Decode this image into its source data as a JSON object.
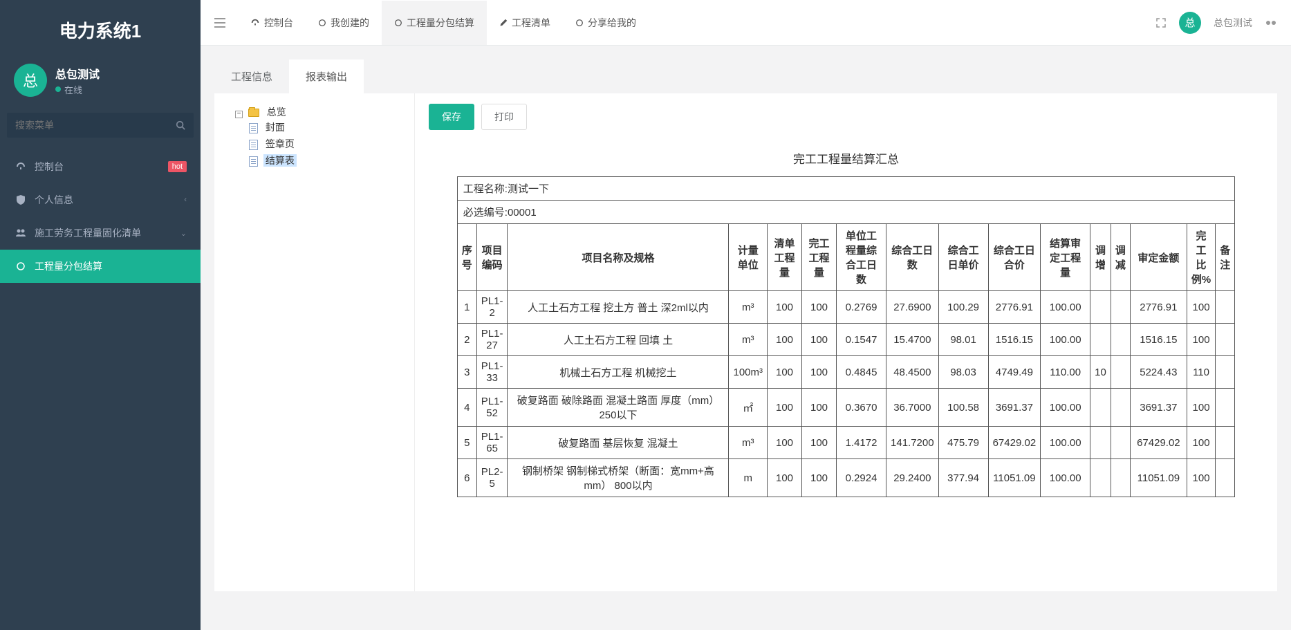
{
  "app": {
    "name": "电力系统1"
  },
  "user": {
    "avatar_char": "总",
    "name": "总包测试",
    "status": "在线"
  },
  "search": {
    "placeholder": "搜索菜单"
  },
  "sidebar": {
    "items": [
      {
        "icon": "dashboard",
        "label": "控制台",
        "badge": "hot"
      },
      {
        "icon": "shield",
        "label": "个人信息",
        "chevron": true
      },
      {
        "icon": "users",
        "label": "施工劳务工程量固化清单",
        "chevron_down": true
      },
      {
        "icon": "circle-o",
        "label": "工程量分包结算",
        "active": true
      }
    ]
  },
  "topnav": {
    "items": [
      {
        "icon": "dashboard",
        "label": "控制台"
      },
      {
        "icon": "circle-o",
        "label": "我创建的"
      },
      {
        "icon": "circle-o",
        "label": "工程量分包结算",
        "active": true
      },
      {
        "icon": "pencil",
        "label": "工程清单"
      },
      {
        "icon": "circle-o",
        "label": "分享给我的"
      }
    ],
    "user_label": "总包测试"
  },
  "inner_tabs": [
    {
      "label": "工程信息"
    },
    {
      "label": "报表输出",
      "active": true
    }
  ],
  "tree": {
    "root": {
      "label": "总览"
    },
    "children": [
      {
        "label": "封面"
      },
      {
        "label": "签章页"
      },
      {
        "label": "结算表",
        "selected": true
      }
    ]
  },
  "actions": {
    "save": "保存",
    "print": "打印"
  },
  "report": {
    "title": "完工工程量结算汇总",
    "project_name_label": "工程名称:",
    "project_name": "测试一下",
    "req_no_label": "必选编号:",
    "req_no": "00001",
    "headers": [
      "序号",
      "项目编码",
      "项目名称及规格",
      "计量单位",
      "清单工程量",
      "完工工程量",
      "单位工程量综合工日数",
      "综合工日数",
      "综合工日单价",
      "综合工日合价",
      "结算审定工程量",
      "调增",
      "调减",
      "审定金额",
      "完工比例%",
      "备注"
    ],
    "rows": [
      {
        "seq": "1",
        "code": "PL1-2",
        "name": "人工土石方工程 挖土方 普土 深2ml以内",
        "unit": "m³",
        "q1": "100",
        "q2": "100",
        "u": "0.2769",
        "d": "27.6900",
        "p": "100.29",
        "sum": "2776.91",
        "aq": "100.00",
        "inc": "",
        "dec": "",
        "amt": "2776.91",
        "pct": "100",
        "note": ""
      },
      {
        "seq": "2",
        "code": "PL1-27",
        "name": "人工土石方工程 回填 土",
        "unit": "m³",
        "q1": "100",
        "q2": "100",
        "u": "0.1547",
        "d": "15.4700",
        "p": "98.01",
        "sum": "1516.15",
        "aq": "100.00",
        "inc": "",
        "dec": "",
        "amt": "1516.15",
        "pct": "100",
        "note": ""
      },
      {
        "seq": "3",
        "code": "PL1-33",
        "name": "机械土石方工程 机械挖土",
        "unit": "100m³",
        "q1": "100",
        "q2": "100",
        "u": "0.4845",
        "d": "48.4500",
        "p": "98.03",
        "sum": "4749.49",
        "aq": "110.00",
        "inc": "10",
        "dec": "",
        "amt": "5224.43",
        "pct": "110",
        "note": ""
      },
      {
        "seq": "4",
        "code": "PL1-52",
        "name": "破复路面 破除路面 混凝土路面 厚度（mm） 250以下",
        "unit": "㎡",
        "q1": "100",
        "q2": "100",
        "u": "0.3670",
        "d": "36.7000",
        "p": "100.58",
        "sum": "3691.37",
        "aq": "100.00",
        "inc": "",
        "dec": "",
        "amt": "3691.37",
        "pct": "100",
        "note": ""
      },
      {
        "seq": "5",
        "code": "PL1-65",
        "name": "破复路面 基层恢复 混凝土",
        "unit": "m³",
        "q1": "100",
        "q2": "100",
        "u": "1.4172",
        "d": "141.7200",
        "p": "475.79",
        "sum": "67429.02",
        "aq": "100.00",
        "inc": "",
        "dec": "",
        "amt": "67429.02",
        "pct": "100",
        "note": ""
      },
      {
        "seq": "6",
        "code": "PL2-5",
        "name": "钢制桥架 钢制梯式桥架（断面：宽mm+高mm） 800以内",
        "unit": "m",
        "q1": "100",
        "q2": "100",
        "u": "0.2924",
        "d": "29.2400",
        "p": "377.94",
        "sum": "11051.09",
        "aq": "100.00",
        "inc": "",
        "dec": "",
        "amt": "11051.09",
        "pct": "100",
        "note": ""
      }
    ]
  }
}
